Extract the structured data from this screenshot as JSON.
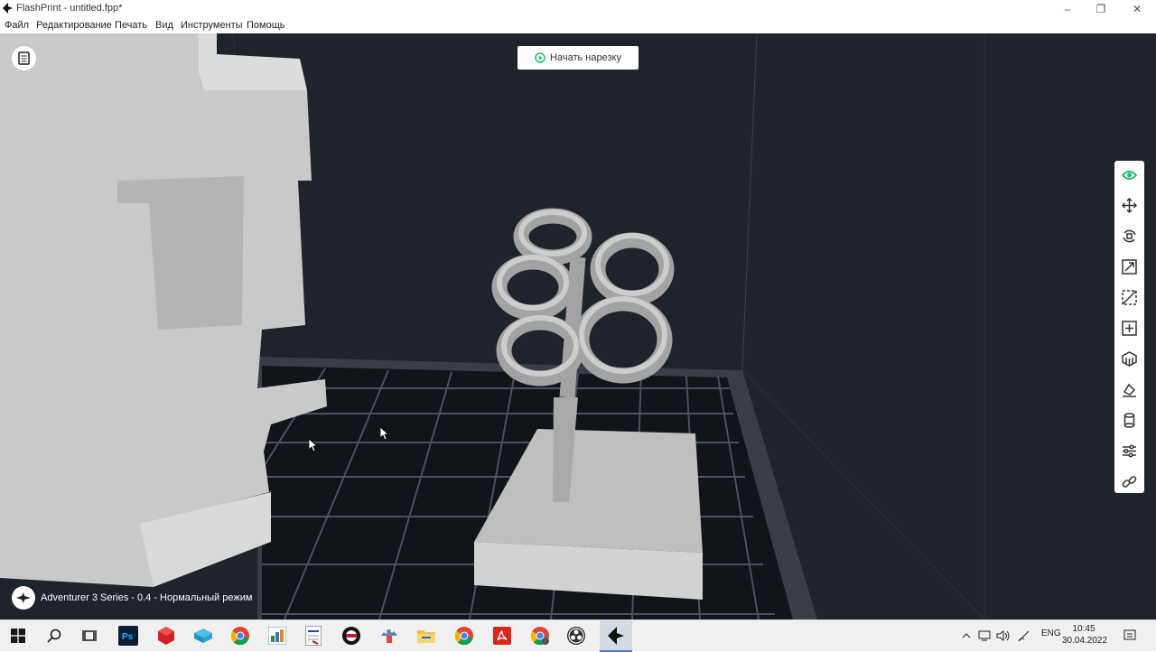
{
  "window": {
    "title": "FlashPrint - untitled.fpp*"
  },
  "menu": [
    "Файл",
    "Редактирование",
    "Печать",
    "Вид",
    "Инструменты",
    "Помощь"
  ],
  "viewport": {
    "slice_button": "Начать нарезку",
    "status": "Adventurer 3 Series - 0.4 - Нормальный режим",
    "toolbar_icons": [
      "eye-icon",
      "move-icon",
      "rotate-icon",
      "scale-icon",
      "cut-icon",
      "add-support-icon",
      "supports-icon",
      "lay-flat-icon",
      "extruder-icon",
      "settings-sliders-icon",
      "link-icon"
    ],
    "accent_color": "#1bbf6b"
  },
  "taskbar": {
    "apps": [
      "windows-start-icon",
      "search-icon",
      "task-view-icon",
      "photoshop-icon",
      "red-box-app-icon",
      "cube-app-icon",
      "chrome-icon",
      "image-app-icon",
      "document-app-icon",
      "app-icon",
      "mushroom-app-icon",
      "file-explorer-icon",
      "chrome-alt-icon",
      "pdf-icon",
      "chrome-alt2-icon",
      "obs-icon",
      "flashprint-icon"
    ],
    "lang": "ENG",
    "time": "10:45",
    "date": "30.04.2022"
  }
}
